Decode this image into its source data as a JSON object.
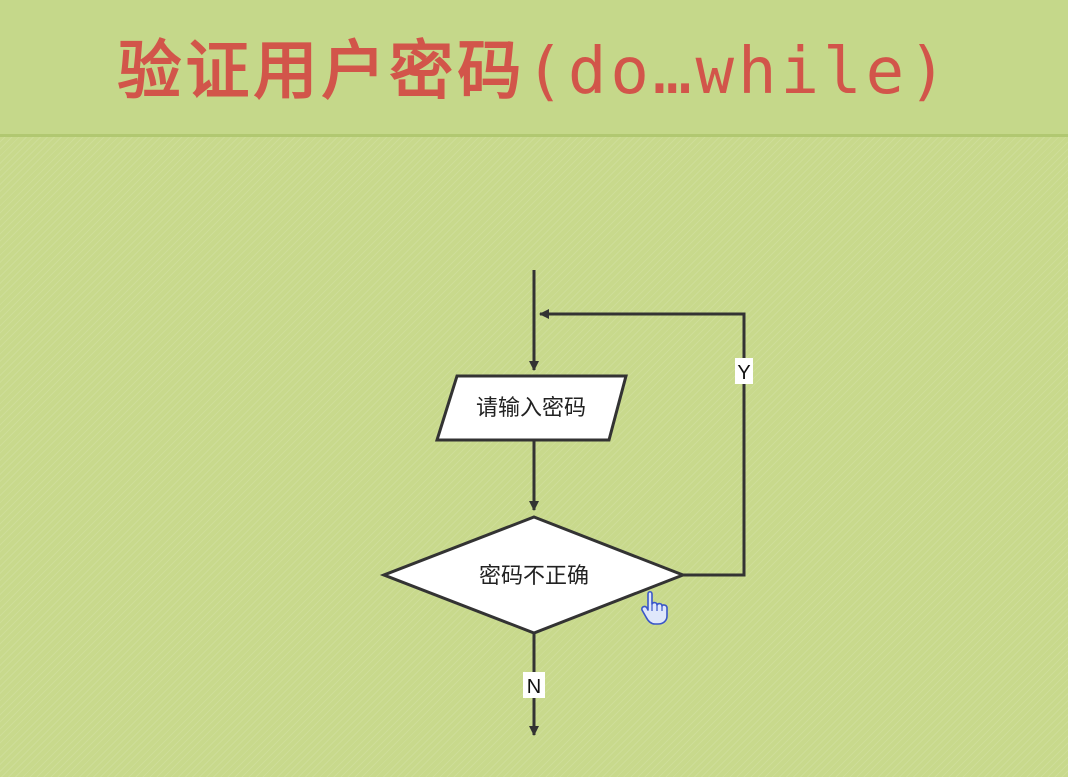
{
  "title": {
    "main": "验证用户密码",
    "paren_open": "(",
    "keyword": "do…while",
    "paren_close": ")"
  },
  "flowchart": {
    "input_label": "请输入密码",
    "decision_label": "密码不正确",
    "yes_label": "Y",
    "no_label": "N"
  },
  "colors": {
    "title": "#d2554a",
    "background": "#c8d98c",
    "line": "#333333",
    "shape_fill": "#ffffff"
  },
  "cursor_icon": "hand-pointer-icon"
}
